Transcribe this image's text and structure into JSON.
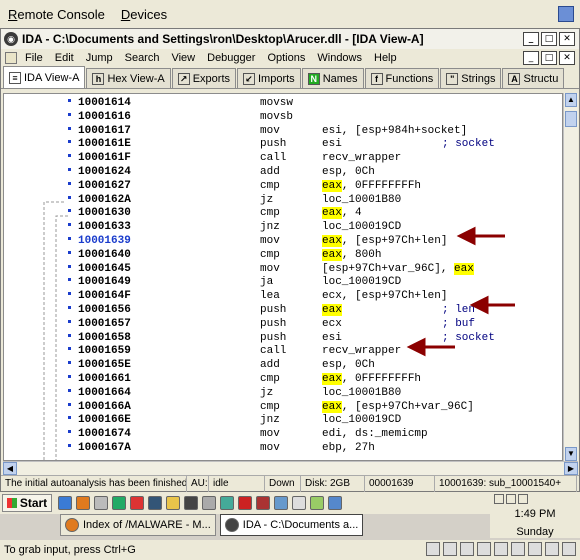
{
  "remote_console": {
    "menu": [
      {
        "label": "Remote Console",
        "accel": "R"
      },
      {
        "label": "Devices",
        "accel": "D"
      }
    ],
    "hint": "To grab input, press Ctrl+G"
  },
  "ida": {
    "title": "IDA - C:\\Documents and Settings\\ron\\Desktop\\Arucer.dll - [IDA View-A]",
    "menu": [
      "File",
      "Edit",
      "Jump",
      "Search",
      "View",
      "Debugger",
      "Options",
      "Windows",
      "Help"
    ],
    "tabs": [
      {
        "label": "IDA View-A",
        "icon": "ida-view-icon",
        "active": true
      },
      {
        "label": "Hex View-A",
        "icon": "hex-view-icon"
      },
      {
        "label": "Exports",
        "icon": "exports-icon"
      },
      {
        "label": "Imports",
        "icon": "imports-icon"
      },
      {
        "label": "Names",
        "icon": "names-icon"
      },
      {
        "label": "Functions",
        "icon": "functions-icon"
      },
      {
        "label": "Strings",
        "icon": "strings-icon"
      },
      {
        "label": "Structu",
        "icon": "structures-icon"
      }
    ],
    "lines": [
      {
        "addr": "10001614",
        "mn": "movsw",
        "op": ""
      },
      {
        "addr": "10001616",
        "mn": "movsb",
        "op": ""
      },
      {
        "addr": "10001617",
        "mn": "mov",
        "op": "esi, [esp+984h+socket]"
      },
      {
        "addr": "1000161E",
        "mn": "push",
        "op": "esi",
        "cm": "; socket"
      },
      {
        "addr": "1000161F",
        "mn": "call",
        "op": "recv_wrapper"
      },
      {
        "addr": "10001624",
        "mn": "add",
        "op": "esp, 0Ch"
      },
      {
        "addr": "10001627",
        "mn": "cmp",
        "op": "eax, 0FFFFFFFFh",
        "hl": "eax"
      },
      {
        "addr": "1000162A",
        "mn": "jz",
        "op": "loc_10001B80"
      },
      {
        "addr": "10001630",
        "mn": "cmp",
        "op": "eax, 4",
        "hl": "eax"
      },
      {
        "addr": "10001633",
        "mn": "jnz",
        "op": "loc_100019CD"
      },
      {
        "addr": "10001639",
        "mn": "mov",
        "op": "eax, [esp+97Ch+len]",
        "hl": "eax",
        "current": true
      },
      {
        "addr": "10001640",
        "mn": "cmp",
        "op": "eax, 800h",
        "hl": "eax"
      },
      {
        "addr": "10001645",
        "mn": "mov",
        "op": "[esp+97Ch+var_96C], eax",
        "hl_end": "eax"
      },
      {
        "addr": "10001649",
        "mn": "ja",
        "op": "loc_100019CD"
      },
      {
        "addr": "1000164F",
        "mn": "lea",
        "op": "ecx, [esp+97Ch+len]"
      },
      {
        "addr": "10001656",
        "mn": "push",
        "op": "eax",
        "cm": "; len",
        "hl": "eax"
      },
      {
        "addr": "10001657",
        "mn": "push",
        "op": "ecx",
        "cm": "; buf"
      },
      {
        "addr": "10001658",
        "mn": "push",
        "op": "esi",
        "cm": "; socket"
      },
      {
        "addr": "10001659",
        "mn": "call",
        "op": "recv_wrapper"
      },
      {
        "addr": "1000165E",
        "mn": "add",
        "op": "esp, 0Ch"
      },
      {
        "addr": "10001661",
        "mn": "cmp",
        "op": "eax, 0FFFFFFFFh",
        "hl": "eax"
      },
      {
        "addr": "10001664",
        "mn": "jz",
        "op": "loc_10001B80"
      },
      {
        "addr": "1000166A",
        "mn": "cmp",
        "op": "eax, [esp+97Ch+var_96C]",
        "hl": "eax"
      },
      {
        "addr": "1000166E",
        "mn": "jnz",
        "op": "loc_100019CD"
      },
      {
        "addr": "10001674",
        "mn": "mov",
        "op": "edi, ds:_memicmp"
      },
      {
        "addr": "1000167A",
        "mn": "mov",
        "op": "ebp, 27h"
      }
    ],
    "status": [
      "The initial autoanalysis has been finished.",
      "AU:",
      "idle",
      "Down",
      "Disk: 2GB",
      "00001639",
      "10001639: sub_10001540+"
    ]
  },
  "taskbar": {
    "start": "Start",
    "tasks": [
      {
        "label": "Index of /MALWARE - M...",
        "active": false
      },
      {
        "label": "IDA - C:\\Documents a...",
        "active": true
      }
    ],
    "time": "1:49 PM",
    "day": "Sunday"
  },
  "colors": {
    "highlight": "#ffff00",
    "arrow": "#8b0000",
    "current_addr": "#1a3ccc"
  }
}
